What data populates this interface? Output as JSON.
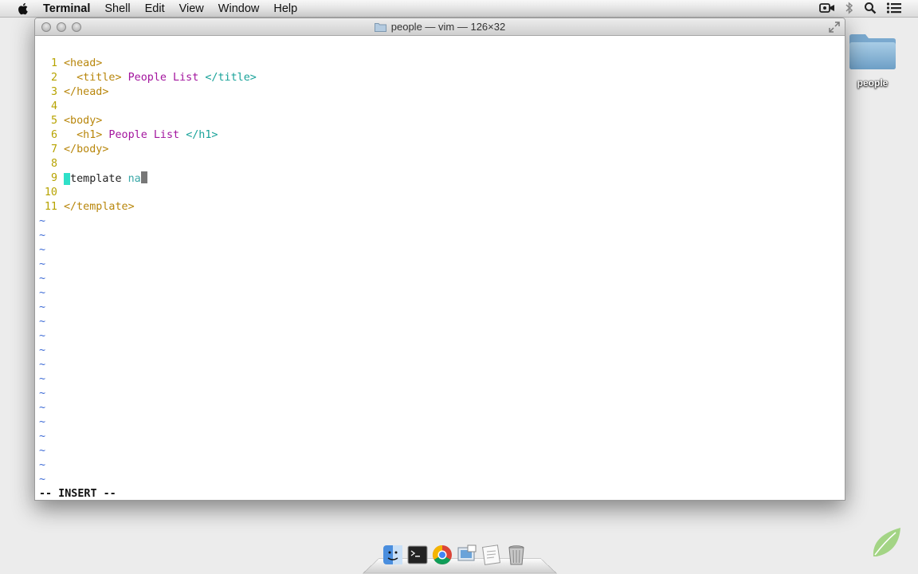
{
  "menubar": {
    "items": [
      "Terminal",
      "Shell",
      "Edit",
      "View",
      "Window",
      "Help"
    ]
  },
  "window": {
    "title": "people — vim — 126×32"
  },
  "desktop": {
    "folder_label": "people"
  },
  "editor": {
    "lines": [
      {
        "num": "1",
        "parts": [
          {
            "t": "<head>",
            "c": "tag"
          }
        ]
      },
      {
        "num": "2",
        "parts": [
          {
            "t": "  ",
            "c": "plain"
          },
          {
            "t": "<title>",
            "c": "tag"
          },
          {
            "t": " People List ",
            "c": "txt"
          },
          {
            "t": "</title>",
            "c": "tag teal"
          }
        ]
      },
      {
        "num": "3",
        "parts": [
          {
            "t": "</head>",
            "c": "tag"
          }
        ]
      },
      {
        "num": "4",
        "parts": []
      },
      {
        "num": "5",
        "parts": [
          {
            "t": "<body>",
            "c": "tag"
          }
        ]
      },
      {
        "num": "6",
        "parts": [
          {
            "t": "  ",
            "c": "plain"
          },
          {
            "t": "<h1>",
            "c": "tag"
          },
          {
            "t": " People List ",
            "c": "txt"
          },
          {
            "t": "</h1>",
            "c": "tag teal"
          }
        ]
      },
      {
        "num": "7",
        "parts": [
          {
            "t": "</body>",
            "c": "tag"
          }
        ]
      },
      {
        "num": "8",
        "parts": []
      },
      {
        "num": "9",
        "parts": [
          {
            "t": "<",
            "c": "cursor-hl"
          },
          {
            "t": "template ",
            "c": "plain"
          },
          {
            "t": "na",
            "c": "attr"
          }
        ]
      },
      {
        "num": "10",
        "parts": []
      },
      {
        "num": "11",
        "parts": [
          {
            "t": "</template>",
            "c": "tag"
          }
        ]
      }
    ],
    "tilde": "~",
    "tilde_count": 19,
    "mode": "-- INSERT --"
  },
  "colors": {
    "line_number": "#b7a300",
    "tag": "#b8860b",
    "text": "#a3159e",
    "tilde": "#3d6bd6"
  },
  "dock": {
    "icons": [
      "finder-icon",
      "terminal-icon",
      "chrome-icon",
      "preview-icon",
      "textedit-icon",
      "trash-icon"
    ]
  }
}
